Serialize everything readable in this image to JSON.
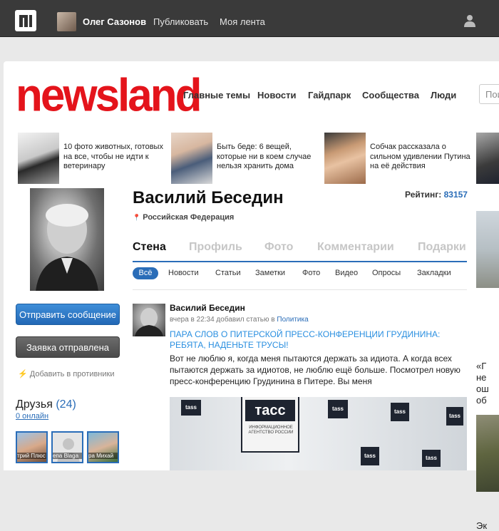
{
  "topbar": {
    "user_name": "Олег Сазонов",
    "publish": "Публиковать",
    "feed": "Моя лента"
  },
  "brand": "newsland",
  "main_nav": [
    "Главные темы",
    "Новости",
    "Гайдпарк",
    "Сообщества",
    "Люди"
  ],
  "search": {
    "placeholder": "Пои"
  },
  "teasers": [
    "10 фото животных, готовых на все, чтобы не идти к ветеринару",
    "Быть беде: 6 вещей, которые ни в коем случае нельзя хранить дома",
    "Собчак рассказала о сильном удивлении Путина на её действия"
  ],
  "right_col": {
    "text": "«Г\nне\nош\nоб",
    "bottom": "Эк"
  },
  "profile": {
    "name": "Василий Беседин",
    "rating_label": "Рейтинг:",
    "rating_value": "83157",
    "location": "Российская Федерация",
    "send_message": "Отправить сообщение",
    "request_sent": "Заявка отправлена",
    "add_enemy": "Добавить в противники",
    "friends_label": "Друзья",
    "friends_count": "(24)",
    "online": "0 онлайн",
    "friends": [
      "трий Плюс",
      "ena Blaga",
      "ра Михай"
    ]
  },
  "tabs": [
    "Стена",
    "Профиль",
    "Фото",
    "Комментарии",
    "Подарки"
  ],
  "subtabs": [
    "Всё",
    "Новости",
    "Статьи",
    "Заметки",
    "Фото",
    "Видео",
    "Опросы",
    "Закладки"
  ],
  "post": {
    "author": "Василий Беседин",
    "meta_prefix": "вчера в 22:34 добавил статью в",
    "category": "Политика",
    "title": "ПАРА СЛОВ О ПИТЕРСКОЙ ПРЕСС-КОНФЕРЕНЦИИ ГРУДИНИНА: РЕБЯТА, НАДЕНЬТЕ ТРУСЫ!",
    "body": "Вот не люблю я, когда меня пытаются держать за идиота. А когда всех пытаются держать за идиотов, не люблю ещё больше. Посмотрел новую пресс-конференцию Грудинина в Питере. Вы меня",
    "image_brand": "тасс",
    "image_caption": "ИНФОРМАЦИОННОЕ АГЕНТСТВО РОССИИ",
    "image_brand_small": "tass"
  },
  "colors": {
    "brand_red": "#e4141b",
    "link_blue": "#2a6db8",
    "topbar": "#3a3a3a"
  }
}
